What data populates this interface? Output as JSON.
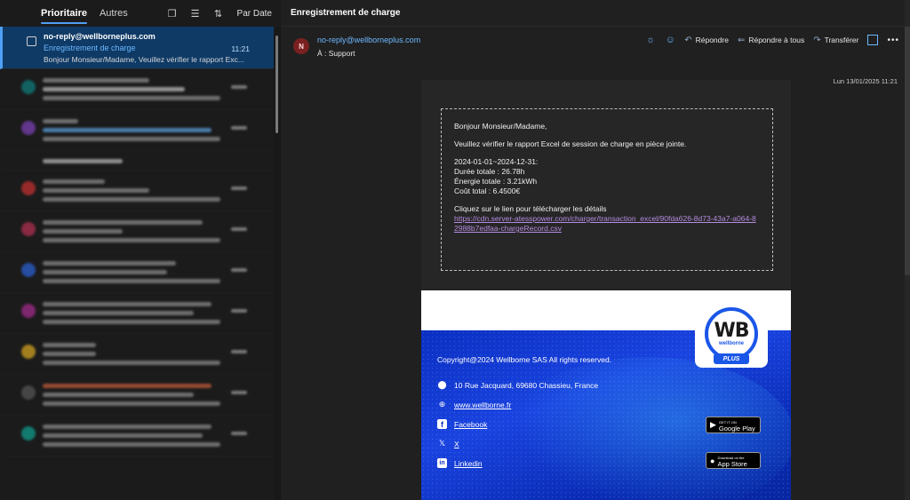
{
  "list": {
    "tabs": [
      "Prioritaire",
      "Autres"
    ],
    "sort_label": "Par Date",
    "selected": {
      "sender": "no-reply@wellborneplus.com",
      "subject": "Enregistrement de charge",
      "preview": "Bonjour Monsieur/Madame, Veuillez vérifier le rapport Exc...",
      "time": "11:21"
    }
  },
  "reading": {
    "title": "Enregistrement de charge",
    "avatar_initial": "N",
    "from": "no-reply@wellborneplus.com",
    "to": "À : Support",
    "date": "Lun 13/01/2025 11:21",
    "actions": {
      "reply": "Répondre",
      "reply_all": "Répondre à tous",
      "forward": "Transférer"
    },
    "body": {
      "greeting": "Bonjour Monsieur/Madame,",
      "instruction": "Veuillez vérifier le rapport Excel de session de charge en pièce jointe.",
      "period": "2024-01-01~2024-12-31:",
      "duration": "Durée totale : 26.78h",
      "energy": "Énergie totale : 3.21kWh",
      "cost": "Coût total : 6.4500€",
      "link_intro": "Cliquez sur le lien pour télécharger les détails",
      "link": "https://cdn.server-atesspower.com/charger/transaction_excel/90fda626-8d73-43a7-a064-82988b7edfaa-chargeRecord.csv"
    },
    "footer": {
      "copyright": "Copyright@2024 Wellborne SAS All rights reserved.",
      "address": "10 Rue Jacquard, 69680 Chassieu, France",
      "website": "www.wellborne.fr",
      "facebook": "Facebook",
      "x": "X",
      "linkedin": "Linkedin",
      "google_play_small": "GET IT ON",
      "google_play": "Google Play",
      "app_store_small": "Download on the",
      "app_store": "App Store",
      "logo_text": "WB",
      "logo_small": "wellborne",
      "logo_plus": "PLUS"
    }
  },
  "colors": {
    "accent": "#4f9ff5",
    "link_blue": "#6cb8ff",
    "selected_bg": "#0f3a66",
    "banner_blue": "#1a43e0"
  }
}
